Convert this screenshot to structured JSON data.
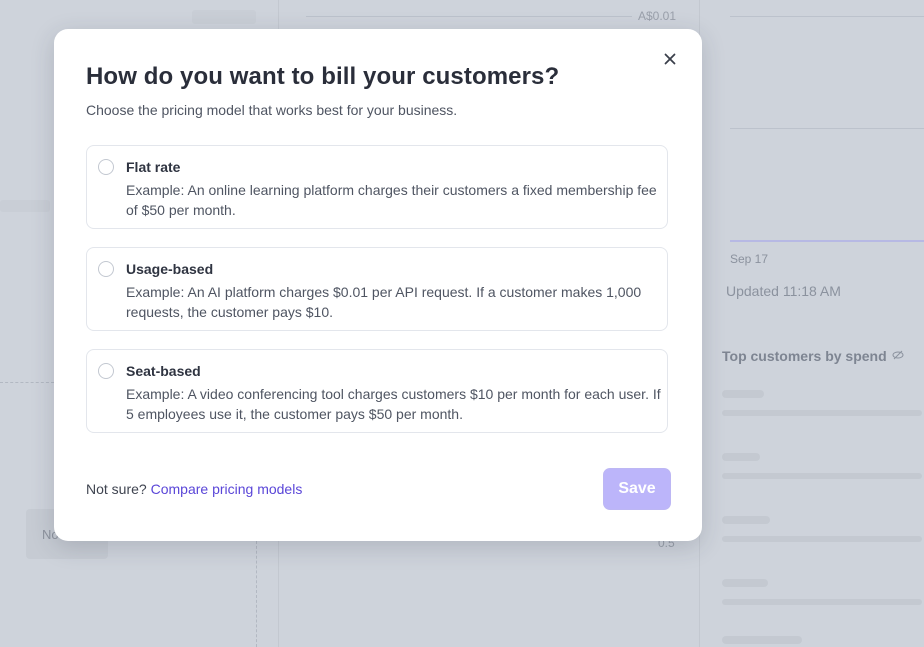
{
  "background": {
    "chart_top_value": "A$0.01",
    "chart_bottom_value": "0.5",
    "date_label": "Sep 17",
    "updated_text": "Updated 11:18 AM",
    "top_customers_title": "Top customers by spend",
    "left_chip_text": "No",
    "overlay_color": "#ced3db",
    "accent_line_color": "#b7b9e4"
  },
  "modal": {
    "title": "How do you want to bill your customers?",
    "subtitle": "Choose the pricing model that works best for your business.",
    "close_icon": "close-icon",
    "options": [
      {
        "label": "Flat rate",
        "description": "Example: An online learning platform charges their customers a fixed membership fee of $50 per month.",
        "selected": false
      },
      {
        "label": "Usage-based",
        "description": "Example: An AI platform charges $0.01 per API request. If a customer makes 1,000 requests, the customer pays $10.",
        "selected": false
      },
      {
        "label": "Seat-based",
        "description": "Example: A video conferencing tool charges customers $10 per month for each user. If 5 employees use it, the customer pays $50 per month.",
        "selected": false
      }
    ],
    "footer": {
      "prefix": "Not sure?",
      "link_text": "Compare pricing models",
      "link_color": "#5a46d8"
    },
    "save_label": "Save",
    "save_color": "#bcb5fa"
  }
}
